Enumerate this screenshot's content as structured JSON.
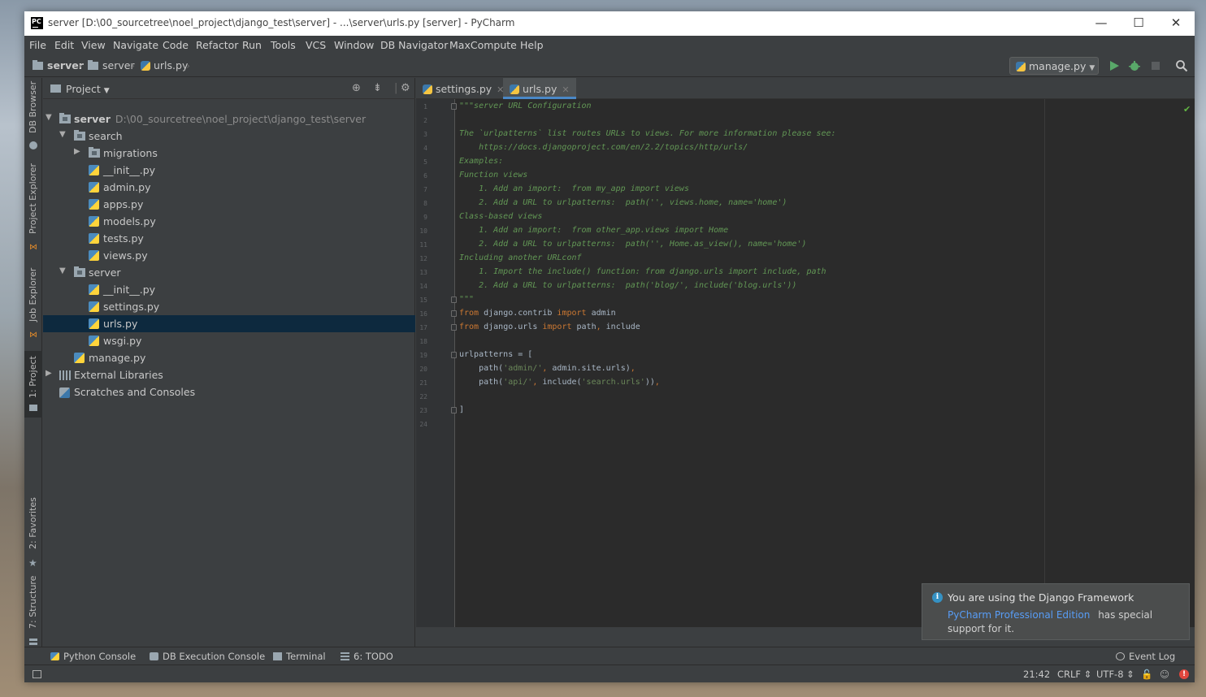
{
  "window": {
    "title": "server [D:\\00_sourcetree\\noel_project\\django_test\\server] - ...\\server\\urls.py [server] - PyCharm",
    "app_logo": "PC",
    "minimize": "—",
    "maximize": "☐",
    "close": "✕"
  },
  "menu": [
    "File",
    "Edit",
    "View",
    "Navigate",
    "Code",
    "Refactor",
    "Run",
    "Tools",
    "VCS",
    "Window",
    "DB Navigator",
    "MaxCompute",
    "Help"
  ],
  "breadcrumb": [
    "server",
    "server",
    "urls.py"
  ],
  "toolbar": {
    "run_config": "manage.py",
    "icons": [
      "run-icon",
      "debug-icon",
      "stop-icon",
      "search-icon"
    ]
  },
  "left_stripe": [
    "DB Browser",
    "Project Explorer",
    "Job Explorer",
    "1: Project",
    "2: Favorites",
    "7: Structure"
  ],
  "project_panel": {
    "title": "Project",
    "tree": [
      {
        "label": "server",
        "path": "D:\\00_sourcetree\\noel_project\\django_test\\server",
        "type": "folder",
        "expanded": true
      },
      {
        "label": "search",
        "type": "folder",
        "expanded": true
      },
      {
        "label": "migrations",
        "type": "folder",
        "expanded": false
      },
      {
        "label": "__init__.py",
        "type": "py"
      },
      {
        "label": "admin.py",
        "type": "py"
      },
      {
        "label": "apps.py",
        "type": "py"
      },
      {
        "label": "models.py",
        "type": "py"
      },
      {
        "label": "tests.py",
        "type": "py"
      },
      {
        "label": "views.py",
        "type": "py"
      },
      {
        "label": "server",
        "type": "folder",
        "expanded": true
      },
      {
        "label": "__init__.py",
        "type": "py"
      },
      {
        "label": "settings.py",
        "type": "py"
      },
      {
        "label": "urls.py",
        "type": "py",
        "selected": true
      },
      {
        "label": "wsgi.py",
        "type": "py"
      },
      {
        "label": "manage.py",
        "type": "py"
      },
      {
        "label": "External Libraries",
        "type": "lib"
      },
      {
        "label": "Scratches and Consoles",
        "type": "scratch"
      }
    ]
  },
  "editor": {
    "tabs": [
      {
        "label": "settings.py",
        "active": false
      },
      {
        "label": "urls.py",
        "active": true
      }
    ],
    "lines": [
      "\"\"\"server URL Configuration",
      "",
      "The `urlpatterns` list routes URLs to views. For more information please see:",
      "    https://docs.djangoproject.com/en/2.2/topics/http/urls/",
      "Examples:",
      "Function views",
      "    1. Add an import:  from my_app import views",
      "    2. Add a URL to urlpatterns:  path('', views.home, name='home')",
      "Class-based views",
      "    1. Add an import:  from other_app.views import Home",
      "    2. Add a URL to urlpatterns:  path('', Home.as_view(), name='home')",
      "Including another URLconf",
      "    1. Import the include() function: from django.urls import include, path",
      "    2. Add a URL to urlpatterns:  path('blog/', include('blog.urls'))",
      "\"\"\"",
      "from django.contrib import admin",
      "from django.urls import path, include",
      "",
      "urlpatterns = [",
      "    path('admin/', admin.site.urls),",
      "    path('api/', include('search.urls')),",
      "",
      "]",
      ""
    ],
    "line_numbers": [
      "1",
      "2",
      "3",
      "4",
      "5",
      "6",
      "7",
      "8",
      "9",
      "10",
      "11",
      "12",
      "13",
      "14",
      "15",
      "16",
      "17",
      "18",
      "19",
      "20",
      "21",
      "22",
      "23",
      "24"
    ]
  },
  "bottom_tools": [
    "Python Console",
    "DB Execution Console",
    "Terminal",
    "6: TODO",
    "Event Log"
  ],
  "status": {
    "position": "21:42",
    "line_sep": "CRLF ⇕",
    "encoding": "UTF-8 ⇕"
  },
  "notification": {
    "title": "You are using the Django Framework",
    "link": "PyCharm Professional Edition",
    "text": "has special support for it."
  },
  "colors": {
    "accent": "#4a88c7",
    "selection": "#0d293e",
    "doc_comment": "#629755",
    "keyword": "#cc7832",
    "string": "#6a8759",
    "run_green": "#59a869"
  }
}
